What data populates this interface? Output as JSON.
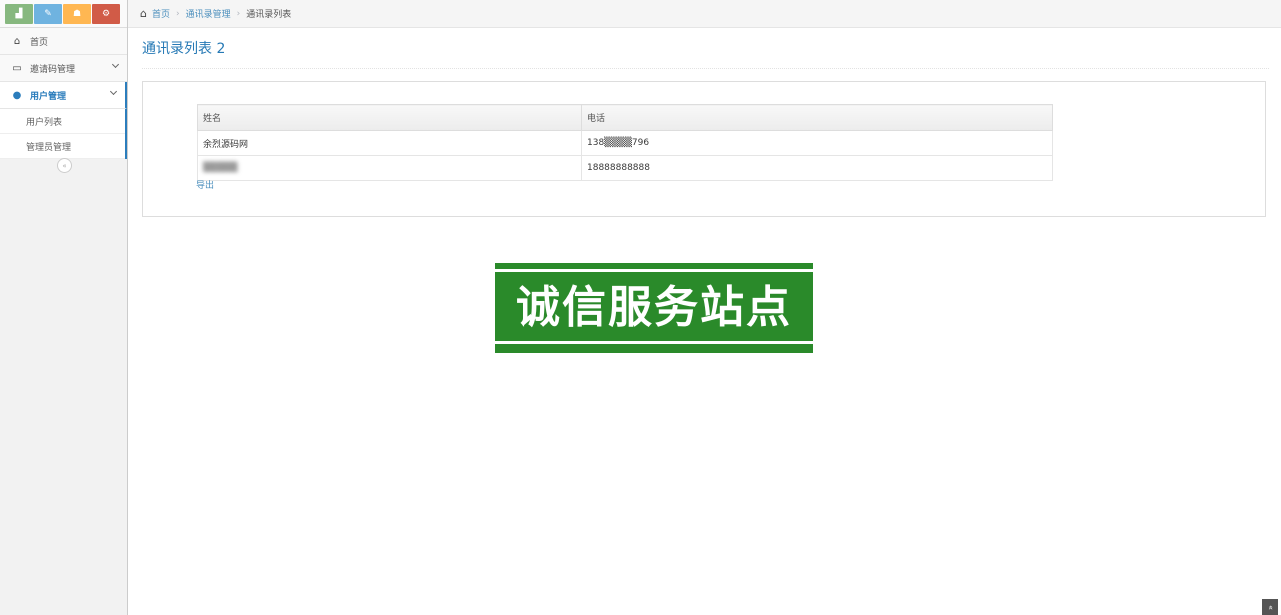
{
  "shortcuts": [
    {
      "icon": "signal-icon",
      "glyph": "▟",
      "color": "#87b87f"
    },
    {
      "icon": "pencil-icon",
      "glyph": "✎",
      "color": "#6fb3e0"
    },
    {
      "icon": "group-icon",
      "glyph": "☗",
      "color": "#ffb752"
    },
    {
      "icon": "cogs-icon",
      "glyph": "⚙",
      "color": "#d15b47"
    }
  ],
  "sidebar": {
    "items": [
      {
        "label": "首页",
        "icon": "home-icon",
        "glyph": "⌂"
      },
      {
        "label": "邀请码管理",
        "icon": "inbox-icon",
        "glyph": "▭"
      },
      {
        "label": "用户管理",
        "icon": "user-icon",
        "glyph": "●"
      }
    ],
    "submenu": [
      {
        "label": "用户列表"
      },
      {
        "label": "管理员管理"
      }
    ],
    "collapse_glyph": "«"
  },
  "breadcrumb": {
    "home": "首页",
    "level2": "通讯录管理",
    "current": "通讯录列表",
    "separator": "›"
  },
  "page": {
    "title": "通讯录列表 2"
  },
  "table": {
    "headers": [
      "姓名",
      "电话"
    ],
    "rows": [
      [
        "余烈源码网",
        "138▒▒▒▒796"
      ],
      [
        "▒▒▒▒▒",
        "18888888888"
      ]
    ]
  },
  "export_label": "导出",
  "watermark": {
    "text": "诚信服务站点"
  },
  "scroll_top_glyph": "»"
}
